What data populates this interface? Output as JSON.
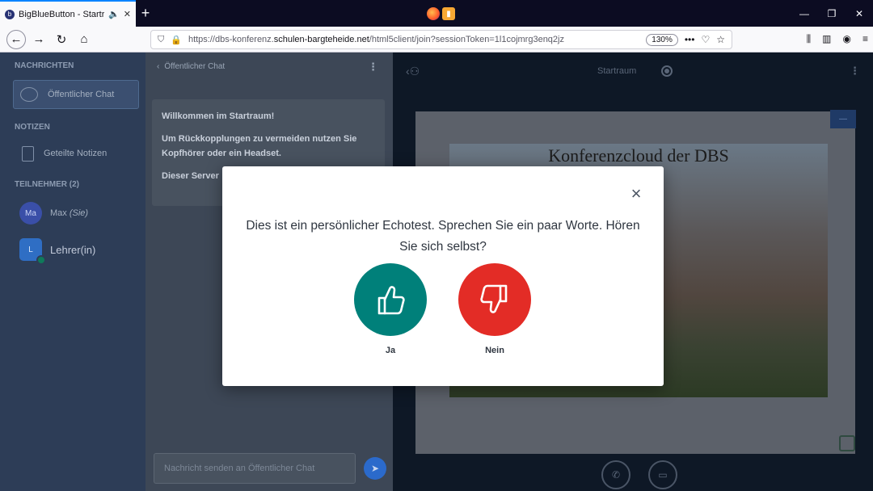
{
  "browser": {
    "tab_title": "BigBlueButton - Startraum",
    "tab_favicon": "b",
    "new_tab": "+",
    "url_prefix": "https://dbs-konferenz.",
    "url_domain": "schulen-bargteheide.net",
    "url_suffix": "/html5client/join?sessionToken=1l1cojmrg3enq2jz",
    "zoom": "130%",
    "more": "•••"
  },
  "sidebar": {
    "messages_title": "NACHRICHTEN",
    "public_chat": "Öffentlicher Chat",
    "notes_title": "NOTIZEN",
    "shared_notes": "Geteilte Notizen",
    "participants_title": "TEILNEHMER (2)",
    "users": [
      {
        "initials": "Ma",
        "name": "Max",
        "suffix": "(Sie)"
      },
      {
        "initials": "L",
        "name": "Lehrer(in)"
      }
    ]
  },
  "chat": {
    "header": "Öffentlicher Chat",
    "welcome": "Willkommen im Startraum!",
    "hint": "Um Rückkopplungen zu vermeiden nutzen Sie Kopfhörer oder ein Headset.",
    "server_line": "Dieser Server",
    "input_placeholder": "Nachricht senden an Öffentlicher Chat"
  },
  "main": {
    "room_title": "Startraum",
    "slide_title": "Konferenzcloud der DBS",
    "slide_button": "—"
  },
  "modal": {
    "text": "Dies ist ein persönlicher Echotest. Sprechen Sie ein paar Worte. Hören Sie sich selbst?",
    "yes_label": "Ja",
    "no_label": "Nein",
    "close": "×"
  },
  "colors": {
    "yes": "#00807a",
    "no": "#e32c26",
    "accent": "#0a84ff"
  }
}
